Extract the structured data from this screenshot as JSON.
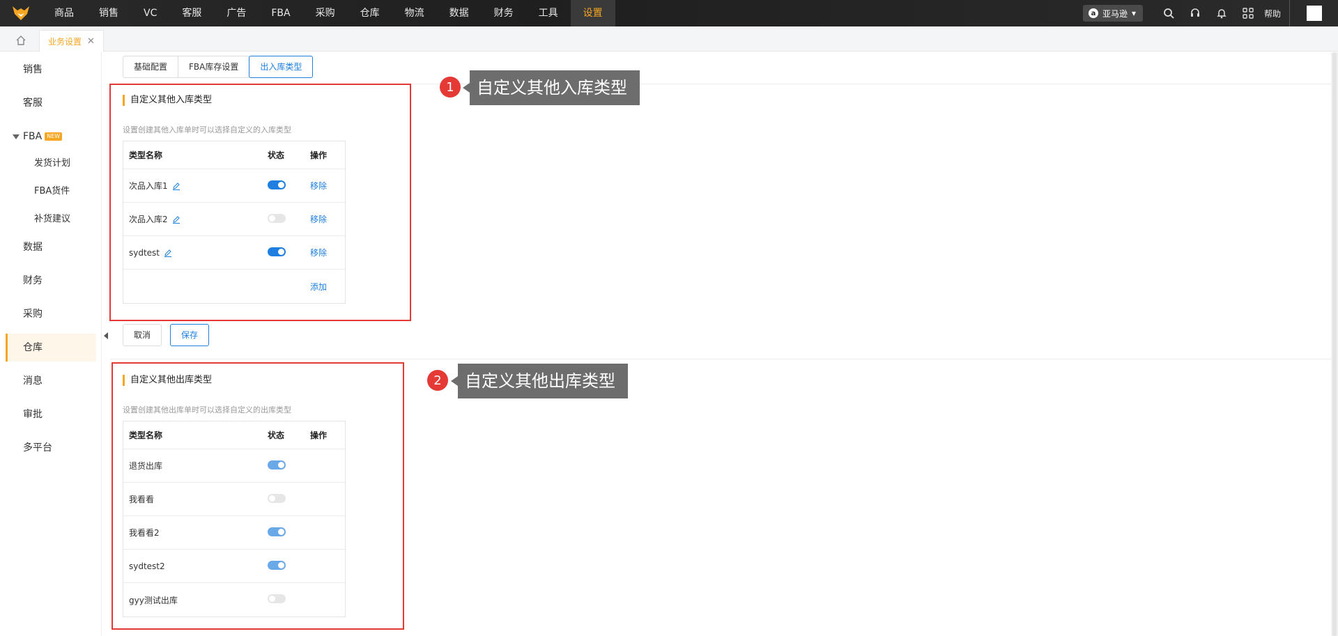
{
  "nav": {
    "items": [
      "商品",
      "销售",
      "VC",
      "客服",
      "广告",
      "FBA",
      "采购",
      "仓库",
      "物流",
      "数据",
      "财务",
      "工具",
      "设置"
    ],
    "active_index": 12,
    "marketplace": "亚马逊",
    "help_label": "帮助"
  },
  "tabs": {
    "current_page": "业务设置"
  },
  "sidebar": {
    "items": [
      "销售",
      "客服",
      "FBA",
      "发货计划",
      "FBA货件",
      "补货建议",
      "数据",
      "财务",
      "采购",
      "仓库",
      "消息",
      "审批",
      "多平台"
    ],
    "fba_badge": "NEW",
    "active": "仓库"
  },
  "subtabs": [
    "基础配置",
    "FBA库存设置",
    "出入库类型"
  ],
  "inbound": {
    "title": "自定义其他入库类型",
    "description": "设置创建其他入库单时可以选择自定义的入库类型",
    "headers": {
      "name": "类型名称",
      "status": "状态",
      "op": "操作"
    },
    "rows": [
      {
        "name": "次品入库1",
        "enabled": true,
        "action": "移除"
      },
      {
        "name": "次品入库2",
        "enabled": false,
        "action": "移除"
      },
      {
        "name": "sydtest",
        "enabled": true,
        "action": "移除"
      }
    ],
    "add_label": "添加"
  },
  "buttons": {
    "cancel": "取消",
    "save": "保存"
  },
  "outbound": {
    "title": "自定义其他出库类型",
    "description": "设置创建其他出库单时可以选择自定义的出库类型",
    "headers": {
      "name": "类型名称",
      "status": "状态",
      "op": "操作"
    },
    "rows": [
      {
        "name": "退货出库",
        "enabled": true
      },
      {
        "name": "我看看",
        "enabled": false
      },
      {
        "name": "我看看2",
        "enabled": true
      },
      {
        "name": "sydtest2",
        "enabled": true
      },
      {
        "name": "gyy测试出库",
        "enabled": false
      }
    ]
  },
  "annotations": [
    {
      "number": "1",
      "text": "自定义其他入库类型"
    },
    {
      "number": "2",
      "text": "自定义其他出库类型"
    }
  ],
  "colors": {
    "accent": "#f5a623",
    "link": "#1e7fe0",
    "annotation": "#e53935"
  }
}
